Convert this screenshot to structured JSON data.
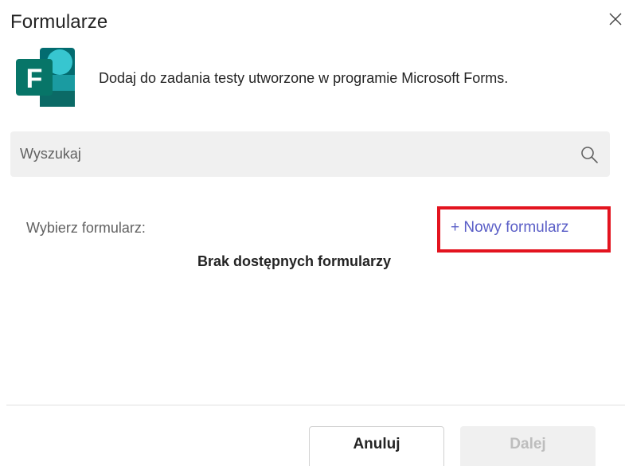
{
  "dialog": {
    "title": "Formularze",
    "description": "Dodaj do zadania testy utworzone w programie Microsoft Forms.",
    "close_icon": "close-icon"
  },
  "logo": {
    "letter": "F",
    "icon": "microsoft-forms-logo",
    "colors": {
      "dark": "#036c70",
      "mid": "#1a9ba1",
      "light": "#37c6d0",
      "tile": "#077568"
    }
  },
  "search": {
    "placeholder": "Wyszukaj",
    "value": "",
    "icon": "search-icon"
  },
  "forms": {
    "choose_label": "Wybierz formularz:",
    "new_form_label": "+ Nowy formularz",
    "empty_message": "Brak dostępnych formularzy",
    "highlight_color": "#e3141f",
    "link_color": "#5b5fc7"
  },
  "footer": {
    "cancel_label": "Anuluj",
    "next_label": "Dalej",
    "next_disabled": true
  }
}
